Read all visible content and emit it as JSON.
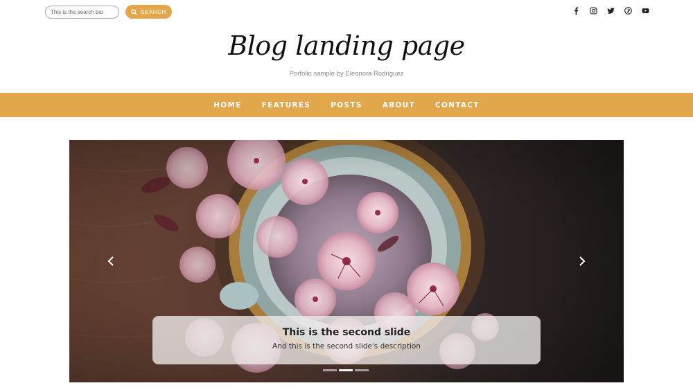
{
  "search": {
    "placeholder": "This is the search bar",
    "button_label": "SEARCH"
  },
  "social": [
    {
      "icon": "facebook-icon"
    },
    {
      "icon": "instagram-icon"
    },
    {
      "icon": "twitter-icon"
    },
    {
      "icon": "pinterest-icon"
    },
    {
      "icon": "youtube-icon"
    }
  ],
  "header": {
    "title": "Blog landing page",
    "subtitle": "Porfolio sample by Eleonora Rodriguez"
  },
  "nav": {
    "items": [
      {
        "label": "HOME"
      },
      {
        "label": "FEATURES"
      },
      {
        "label": "POSTS"
      },
      {
        "label": "ABOUT"
      },
      {
        "label": "CONTACT"
      }
    ]
  },
  "carousel": {
    "caption_title": "This is the second slide",
    "caption_description": "And this is the second slide's description",
    "active_slide": 2,
    "slide_count": 3
  },
  "colors": {
    "accent": "#e3a74b"
  }
}
